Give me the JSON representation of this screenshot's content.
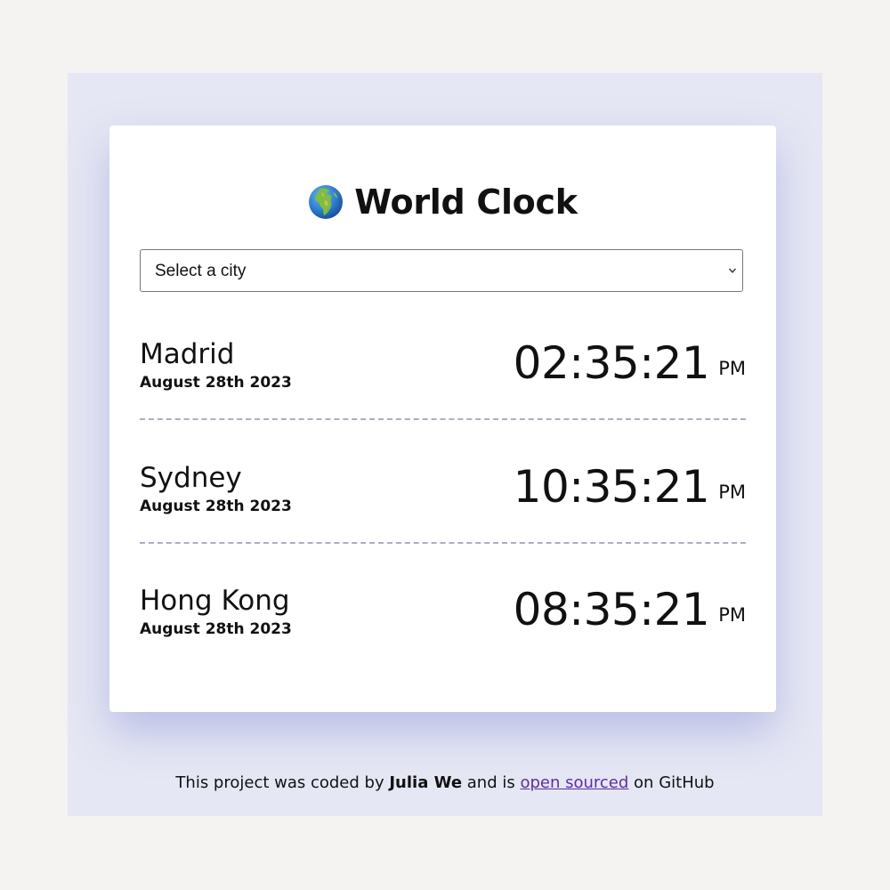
{
  "app": {
    "title": "World Clock",
    "globe_icon": "globe-africa-europe-icon"
  },
  "city_select": {
    "selected": "Select a city",
    "options": [
      "Select a city"
    ]
  },
  "cities": [
    {
      "name": "Madrid",
      "date": "August 28th 2023",
      "time": "02:35:21",
      "ampm": "PM"
    },
    {
      "name": "Sydney",
      "date": "August 28th 2023",
      "time": "10:35:21",
      "ampm": "PM"
    },
    {
      "name": "Hong Kong",
      "date": "August 28th 2023",
      "time": "08:35:21",
      "ampm": "PM"
    }
  ],
  "footer": {
    "prefix": "This project was coded by",
    "author": "Julia We",
    "middle": "and is",
    "link_text": "open sourced",
    "suffix": "on GitHub"
  },
  "colors": {
    "page_background": "#f4f3f1",
    "backdrop": "#e6e7f4",
    "card": "#ffffff",
    "link": "#5b2ea6",
    "divider": "#a9aec4"
  }
}
